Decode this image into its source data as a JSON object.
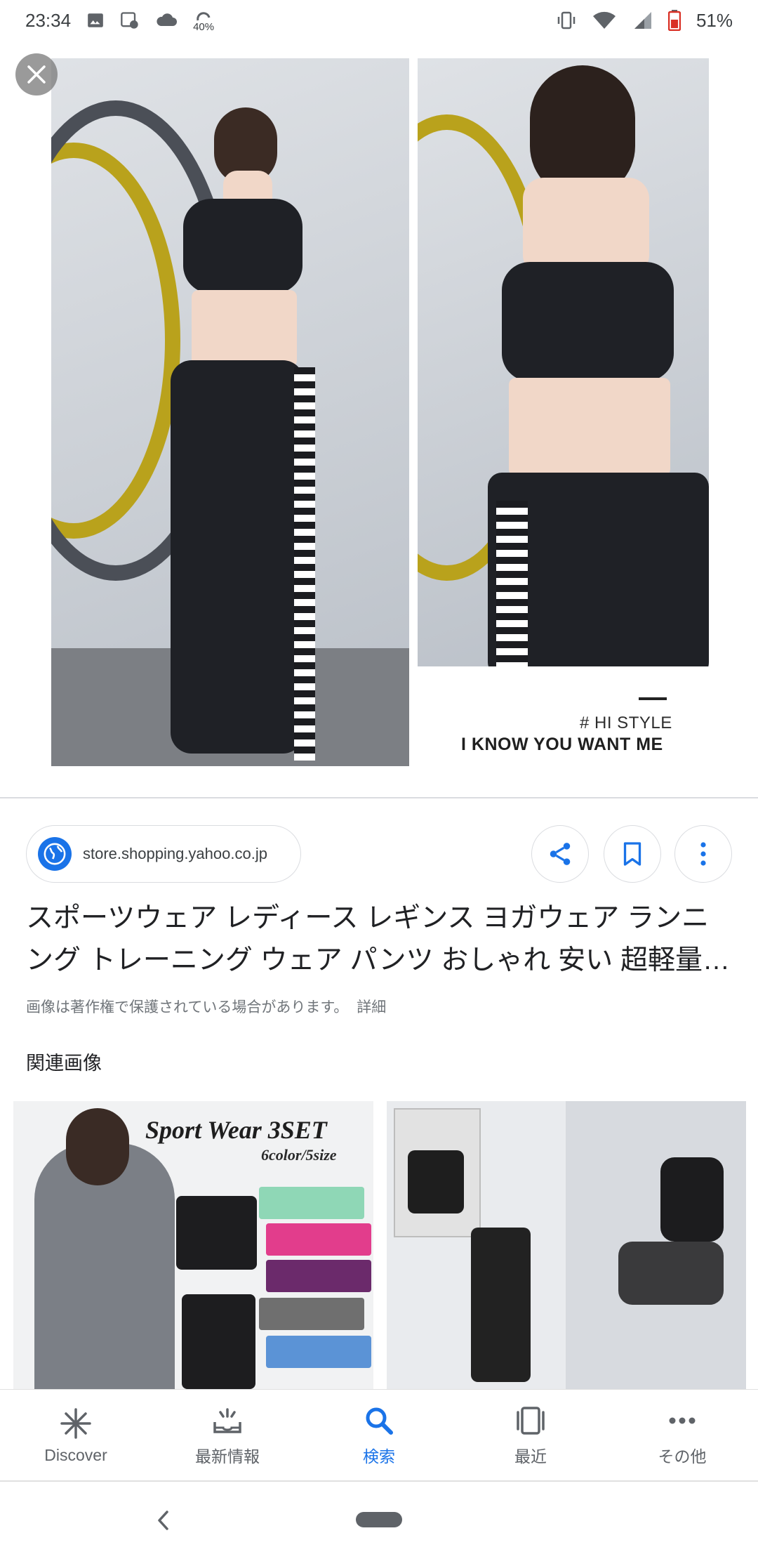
{
  "status_bar": {
    "time": "23:34",
    "data_saver_label": "40%",
    "battery_percent": "51%",
    "icons": [
      "image-icon",
      "screenshot-icon",
      "cloud-icon",
      "data-saver-icon",
      "vibrate-icon",
      "wifi-icon",
      "signal-icon",
      "battery-icon"
    ]
  },
  "hero": {
    "caption_line1": "# HI STYLE",
    "caption_line2": "I KNOW YOU WANT ME"
  },
  "source": {
    "domain": "store.shopping.yahoo.co.jp"
  },
  "title": "スポーツウェア レディース レギンス ヨガウェア ランニング トレーニング ウェア パンツ おしゃれ 安い 超軽量…",
  "copyright": {
    "notice": "画像は著作権で保護されている場合があります。",
    "link": "詳細"
  },
  "related": {
    "heading": "関連画像",
    "image1_text": "Sport Wear 3SET",
    "image1_subtext": "6color/5size"
  },
  "bottom_nav": {
    "items": [
      {
        "label": "Discover",
        "icon": "discover-icon",
        "active": false
      },
      {
        "label": "最新情報",
        "icon": "updates-icon",
        "active": false
      },
      {
        "label": "検索",
        "icon": "search-icon",
        "active": true
      },
      {
        "label": "最近",
        "icon": "recent-icon",
        "active": false
      },
      {
        "label": "その他",
        "icon": "more-icon",
        "active": false
      }
    ]
  },
  "colors": {
    "accent": "#1a73e8",
    "text": "#202124",
    "muted": "#70757a"
  }
}
